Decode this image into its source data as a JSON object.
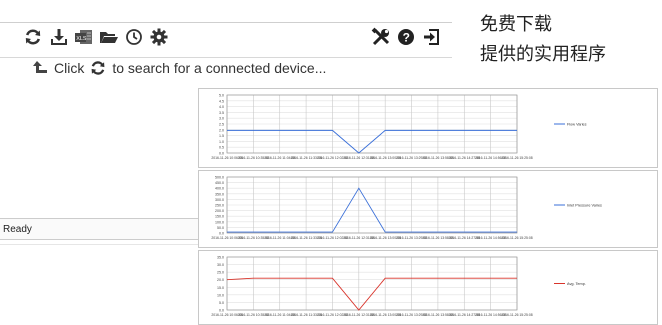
{
  "toolbar": {
    "icons": [
      "refresh-icon",
      "download-icon",
      "xls-export-icon",
      "open-folder-icon",
      "clock-icon",
      "settings-gear-icon",
      "tools-icon",
      "help-icon",
      "exit-icon"
    ]
  },
  "hint": {
    "prefix": "Click",
    "suffix": "to search for a connected device..."
  },
  "status": {
    "text": "Ready"
  },
  "promo": {
    "line1": "免费下载",
    "line2": "提供的实用程序"
  },
  "colors": {
    "blue_series": "#3a6fd8",
    "red_series": "#d9342b",
    "grid": "#c9c9c9"
  },
  "chart_data": [
    {
      "type": "line",
      "x": [
        "2016-11-26 10:06:08",
        "2016-11-26 10:35:08",
        "2016-11-26 11:04:08",
        "2016-11-26 11:33:08",
        "2016-11-26 12:02:08",
        "2016-11-26 12:31:08",
        "2016-11-26 13:00:08",
        "2016-11-26 13:29:08",
        "2016-11-26 13:58:08",
        "2016-11-26 14:27:08",
        "2016-11-26 14:56:08",
        "2016-11-26 15:25:08"
      ],
      "yticks": [
        "0.0",
        "0.5",
        "1.0",
        "1.5",
        "2.0",
        "2.5",
        "3.0",
        "3.5",
        "4.0",
        "4.5",
        "5.0"
      ],
      "ylim": [
        0,
        5.0
      ],
      "series": [
        {
          "name": "Flow Varies",
          "color": "#3a6fd8",
          "values": [
            1.95,
            1.95,
            1.95,
            1.95,
            1.95,
            0.0,
            1.95,
            1.95,
            1.95,
            1.95,
            1.95,
            1.95
          ]
        }
      ],
      "legend": "right"
    },
    {
      "type": "line",
      "x": [
        "2016-11-26 10:06:08",
        "2016-11-26 10:35:08",
        "2016-11-26 11:04:08",
        "2016-11-26 11:33:08",
        "2016-11-26 12:02:08",
        "2016-11-26 12:31:08",
        "2016-11-26 13:00:08",
        "2016-11-26 13:29:08",
        "2016-11-26 13:58:08",
        "2016-11-26 14:27:08",
        "2016-11-26 14:56:08",
        "2016-11-26 15:25:08"
      ],
      "yticks": [
        "0.0",
        "50.0",
        "100.0",
        "150.0",
        "200.0",
        "250.0",
        "300.0",
        "350.0",
        "400.0",
        "450.0",
        "500.0"
      ],
      "ylim": [
        0,
        500
      ],
      "series": [
        {
          "name": "Inlet Pressure Varies",
          "color": "#3a6fd8",
          "values": [
            8,
            8,
            8,
            8,
            8,
            400,
            8,
            8,
            8,
            8,
            8,
            8
          ]
        }
      ],
      "legend": "right"
    },
    {
      "type": "line",
      "x": [
        "2016-11-26 10:06:08",
        "2016-11-26 10:35:08",
        "2016-11-26 11:04:08",
        "2016-11-26 11:33:08",
        "2016-11-26 12:02:08",
        "2016-11-26 12:31:08",
        "2016-11-26 13:00:08",
        "2016-11-26 13:29:08",
        "2016-11-26 13:58:08",
        "2016-11-26 14:27:08",
        "2016-11-26 14:56:08",
        "2016-11-26 15:25:08"
      ],
      "yticks": [
        "0.0",
        "5.0",
        "10.0",
        "15.0",
        "20.0",
        "25.0",
        "30.0",
        "35.0"
      ],
      "ylim": [
        0,
        35
      ],
      "series": [
        {
          "name": "Avg. Temp.",
          "color": "#d9342b",
          "values": [
            20,
            21,
            21,
            21,
            21,
            0,
            21,
            21,
            21,
            21,
            21,
            21
          ]
        }
      ],
      "legend": "right"
    }
  ]
}
